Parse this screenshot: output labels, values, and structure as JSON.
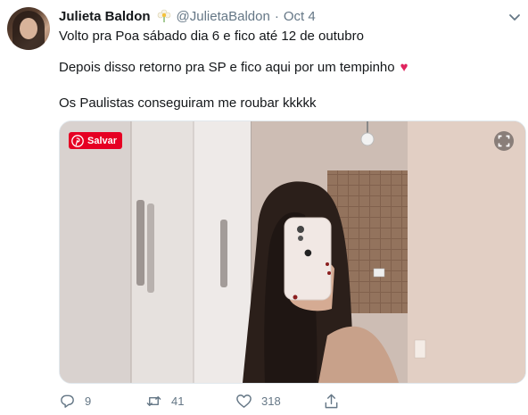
{
  "tweet": {
    "author_name": "Julieta Baldon",
    "handle": "@JulietaBaldon",
    "separator": "·",
    "date": "Oct 4",
    "lines": [
      "Volto pra Poa sábado dia 6 e fico até 12 de outubro",
      "Depois disso retorno pra SP e fico aqui por um tempinho",
      "Os Paulistas conseguiram me roubar kkkkk"
    ],
    "heart_emoji": "♥"
  },
  "media": {
    "pinterest_label": "Salvar",
    "expand_icon": "expand-icon"
  },
  "actions": {
    "reply_count": "9",
    "retweet_count": "41",
    "like_count": "318"
  },
  "colors": {
    "accent": "#1da1f2",
    "secondary_text": "#657786",
    "heart": "#e0245e",
    "pinterest": "#e60023"
  }
}
